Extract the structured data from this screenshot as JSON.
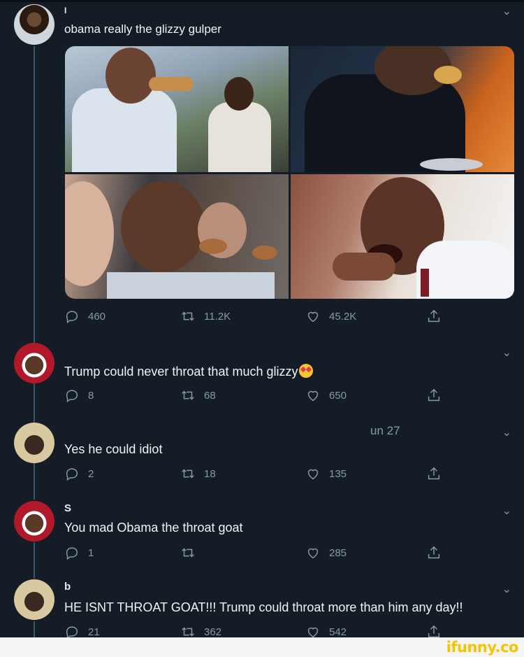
{
  "tweets": [
    {
      "name": "I",
      "text": "obama really the glizzy gulper",
      "replies": "460",
      "retweets": "11.2K",
      "likes": "45.2K"
    },
    {
      "name": "",
      "text": "Trump could never throat that much glizzy",
      "replies": "8",
      "retweets": "68",
      "likes": "650"
    },
    {
      "name": "",
      "date": "un 27",
      "text": "Yes he could idiot",
      "replies": "2",
      "retweets": "18",
      "likes": "135"
    },
    {
      "name": "S",
      "text": "You mad Obama the throat goat",
      "replies": "1",
      "retweets": "",
      "likes": "285"
    },
    {
      "name": "b",
      "text": "HE ISNT THROAT GOAT!!! Trump could throat more than him any day!!",
      "replies": "21",
      "retweets": "362",
      "likes": "542"
    }
  ],
  "watermark": "ifunny.co",
  "colors": {
    "background": "#141d26",
    "muted": "#8899a6",
    "watermark": "#f5c400"
  }
}
